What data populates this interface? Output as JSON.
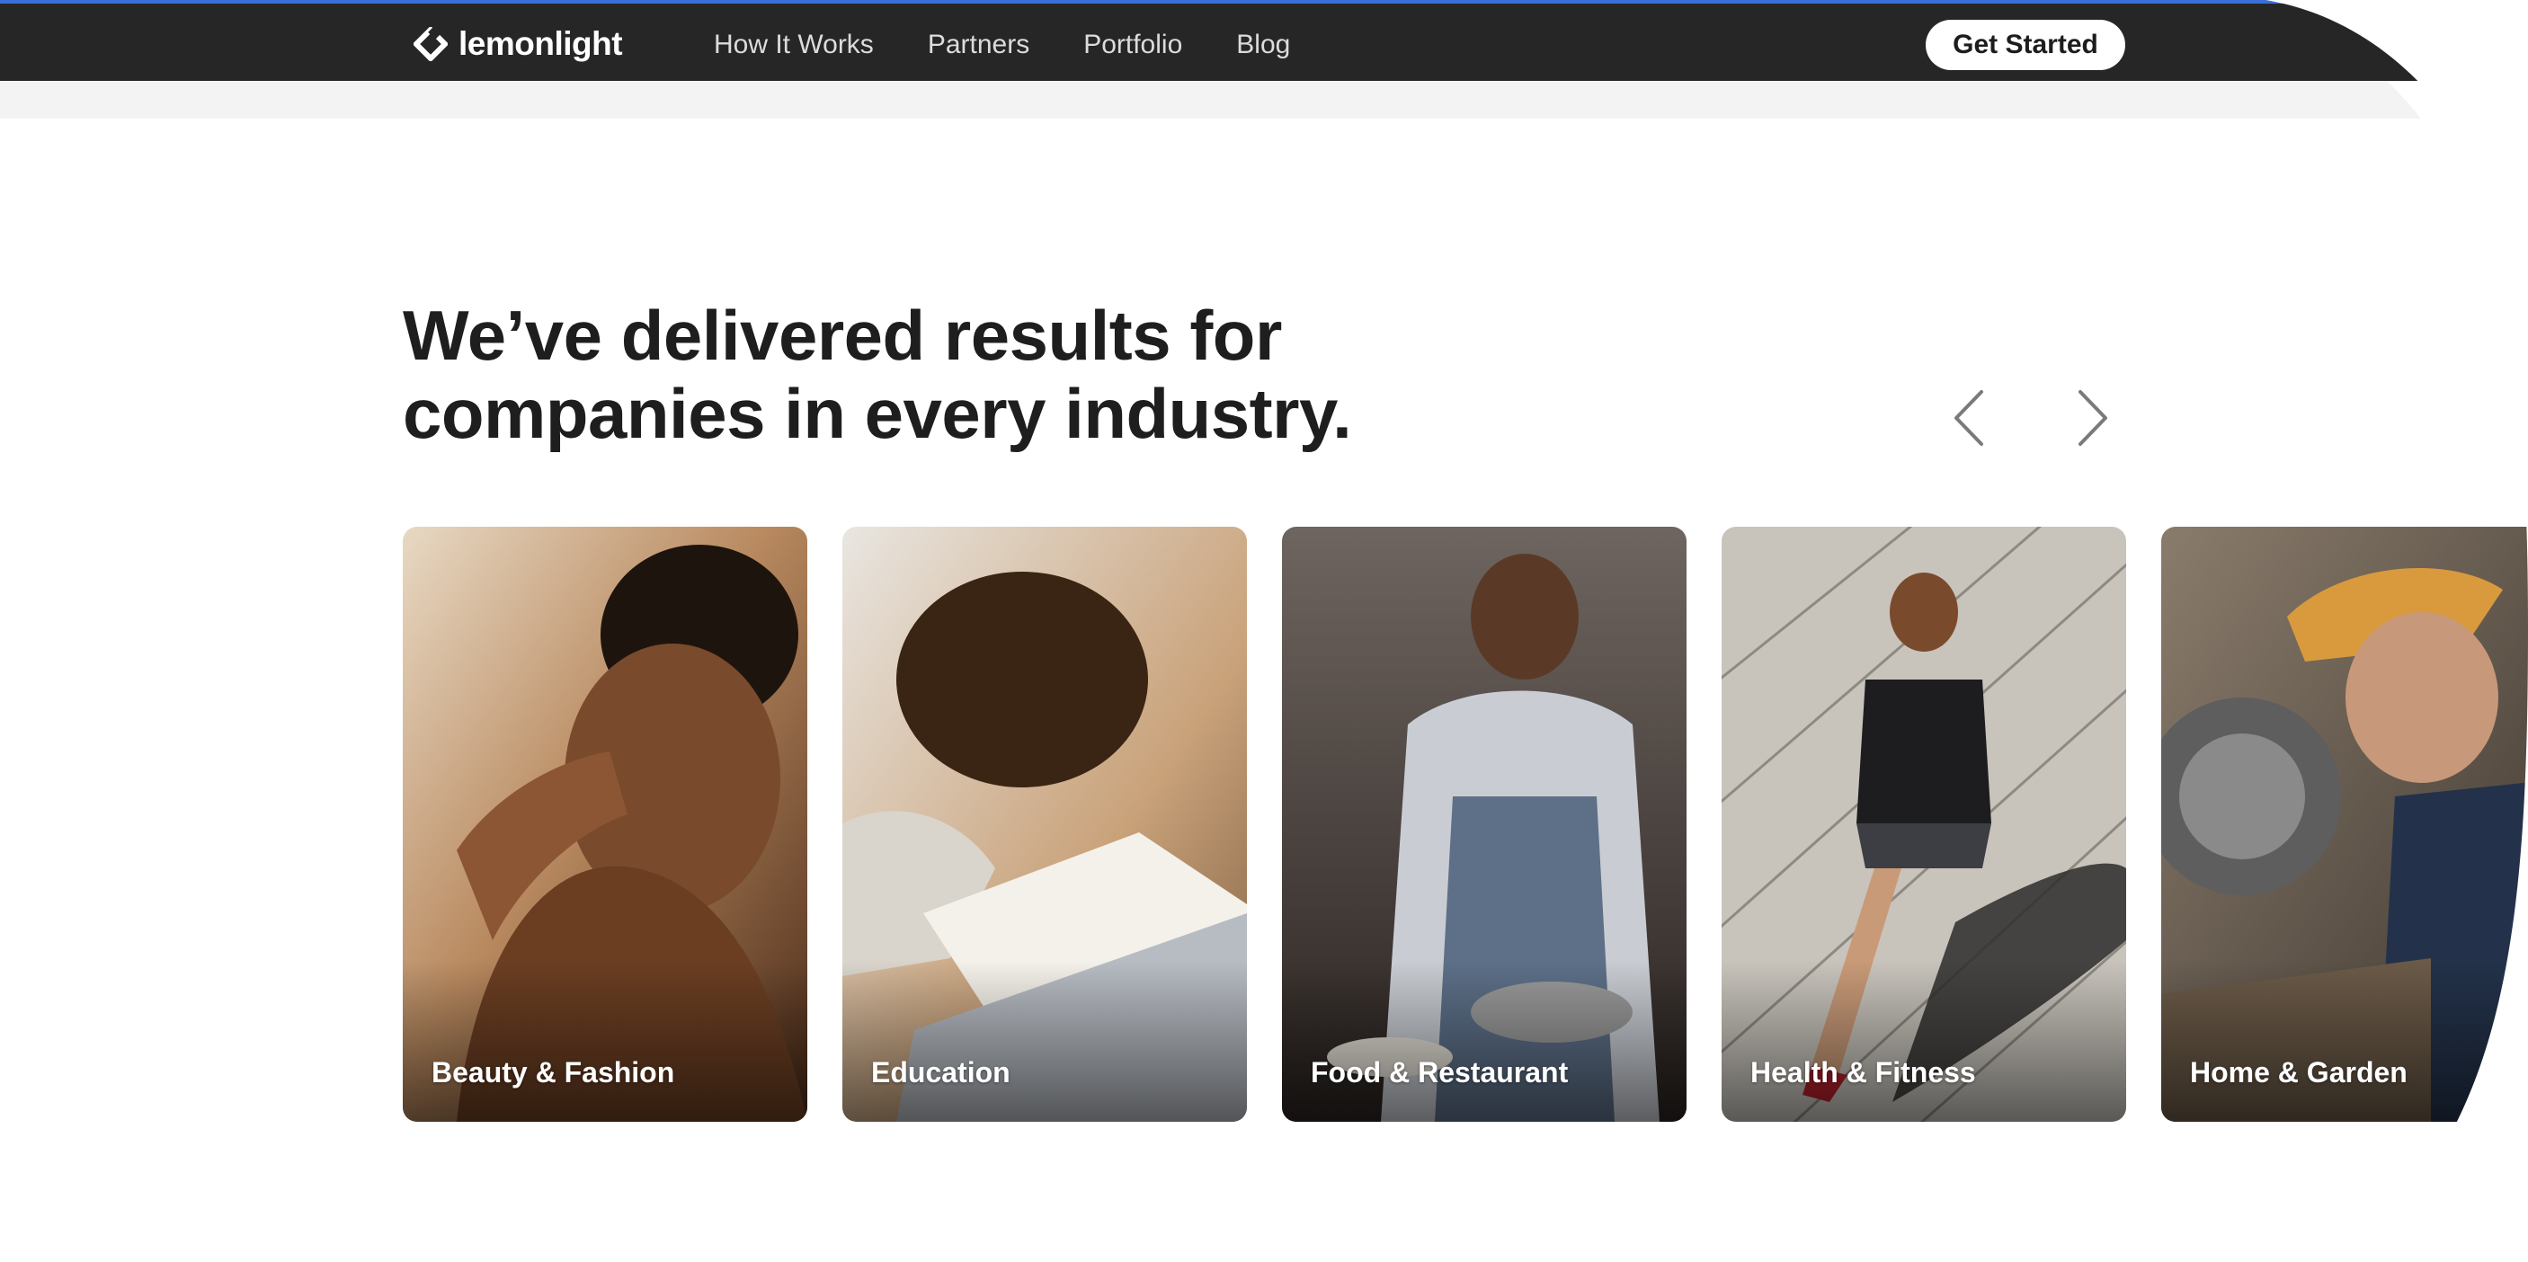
{
  "brand": {
    "name": "lemonlight"
  },
  "nav": {
    "items": [
      {
        "label": "How It Works"
      },
      {
        "label": "Partners"
      },
      {
        "label": "Portfolio"
      },
      {
        "label": "Blog"
      }
    ],
    "cta_label": "Get Started"
  },
  "headline": {
    "line1": "We’ve delivered results for",
    "line2": "companies in every industry."
  },
  "carousel": {
    "prev_icon": "chevron-left-icon",
    "next_icon": "chevron-right-icon"
  },
  "industries": [
    {
      "label": "Beauty & Fashion"
    },
    {
      "label": "Education"
    },
    {
      "label": "Food & Restaurant"
    },
    {
      "label": "Health & Fitness"
    },
    {
      "label": "Home & Garden"
    }
  ],
  "colors": {
    "nav_background": "#262626",
    "accent_line": "#3a6fd8",
    "headline": "#1e1e1e"
  }
}
